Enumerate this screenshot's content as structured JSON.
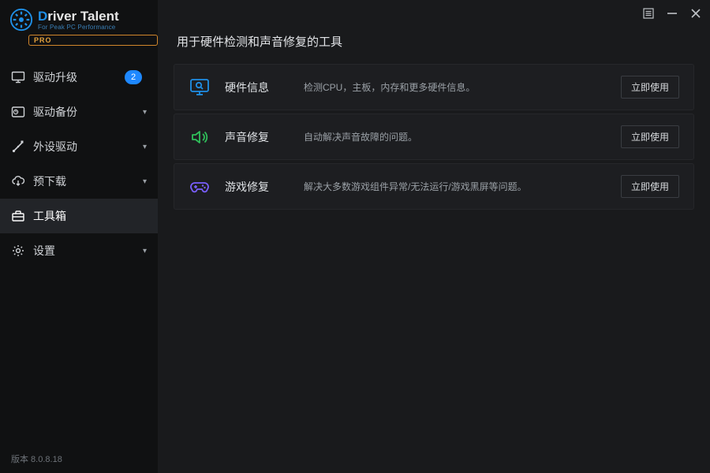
{
  "app": {
    "logo_title_first": "D",
    "logo_title_rest": "river Talent",
    "logo_sub": "For Peak PC Performance",
    "logo_pro": "PRO"
  },
  "sidebar": {
    "items": [
      {
        "label": "驱动升级",
        "badge": "2",
        "has_caret": false
      },
      {
        "label": "驱动备份",
        "badge": null,
        "has_caret": true
      },
      {
        "label": "外设驱动",
        "badge": null,
        "has_caret": true
      },
      {
        "label": "预下载",
        "badge": null,
        "has_caret": true
      },
      {
        "label": "工具箱",
        "badge": null,
        "has_caret": false
      },
      {
        "label": "设置",
        "badge": null,
        "has_caret": true
      }
    ],
    "version": "版本 8.0.8.18"
  },
  "main": {
    "title": "用于硬件检测和声音修复的工具",
    "tools": [
      {
        "name": "硬件信息",
        "desc": "检测CPU，主板，内存和更多硬件信息。",
        "button": "立即使用",
        "icon_color": "#1f8fe6"
      },
      {
        "name": "声音修复",
        "desc": "自动解决声音故障的问题。",
        "button": "立即使用",
        "icon_color": "#2fbf5a"
      },
      {
        "name": "游戏修复",
        "desc": "解决大多数游戏组件异常/无法运行/游戏黑屏等问题。",
        "button": "立即使用",
        "icon_color": "#7a5fff"
      }
    ]
  }
}
